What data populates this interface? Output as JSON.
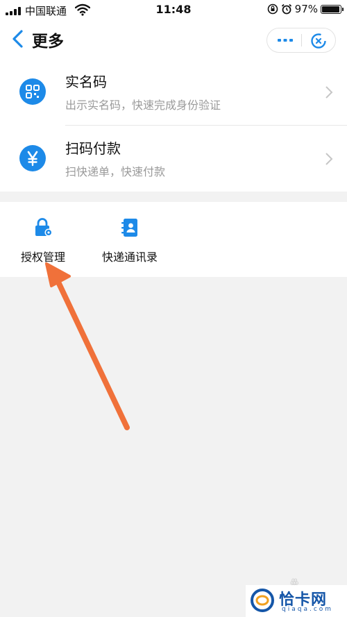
{
  "status_bar": {
    "carrier": "中国联通",
    "time": "11:48",
    "battery_text": "97%",
    "battery_level": 0.97
  },
  "nav": {
    "title": "更多"
  },
  "list": [
    {
      "title": "实名码",
      "subtitle": "出示实名码，快速完成身份验证",
      "icon": "qr-code-icon"
    },
    {
      "title": "扫码付款",
      "subtitle": "扫快递单，快速付款",
      "icon": "yen-icon"
    }
  ],
  "grid": [
    {
      "label": "授权管理",
      "icon": "lock-gear-icon"
    },
    {
      "label": "快递通讯录",
      "icon": "contact-book-icon"
    }
  ],
  "watermark": {
    "name": "恰卡网",
    "url": "qiaqa.com"
  },
  "colors": {
    "accent": "#1d8ae8",
    "arrow": "#f0713a",
    "background": "#f2f2f2"
  }
}
